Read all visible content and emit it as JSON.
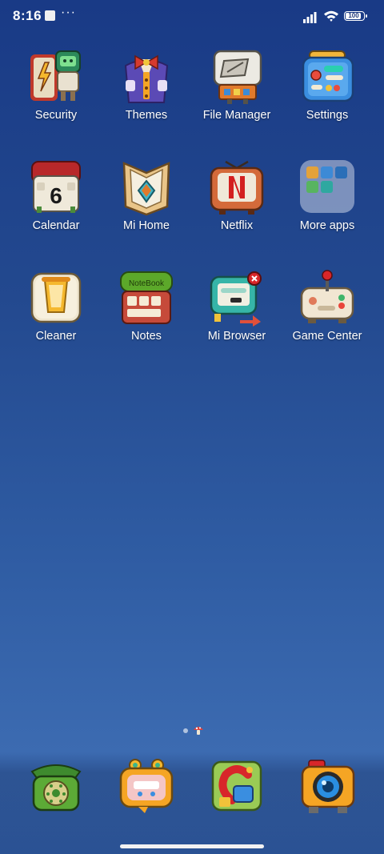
{
  "status_bar": {
    "time": "8:16",
    "battery": "100"
  },
  "apps": [
    {
      "label": "Security"
    },
    {
      "label": "Themes"
    },
    {
      "label": "File Manager"
    },
    {
      "label": "Settings"
    },
    {
      "label": "Calendar",
      "day": "6"
    },
    {
      "label": "Mi Home"
    },
    {
      "label": "Netflix"
    },
    {
      "label": "More apps"
    },
    {
      "label": "Cleaner"
    },
    {
      "label": "Notes",
      "badge_text": "NoteBook"
    },
    {
      "label": "Mi Browser"
    },
    {
      "label": "Game Center"
    }
  ],
  "dock": [
    {
      "icon": "phone-icon"
    },
    {
      "icon": "messaging-icon"
    },
    {
      "icon": "browser-icon"
    },
    {
      "icon": "camera-icon"
    }
  ],
  "colors": {
    "wallpaper_top": "#193a86",
    "wallpaper_bottom": "#3c6bb1"
  }
}
